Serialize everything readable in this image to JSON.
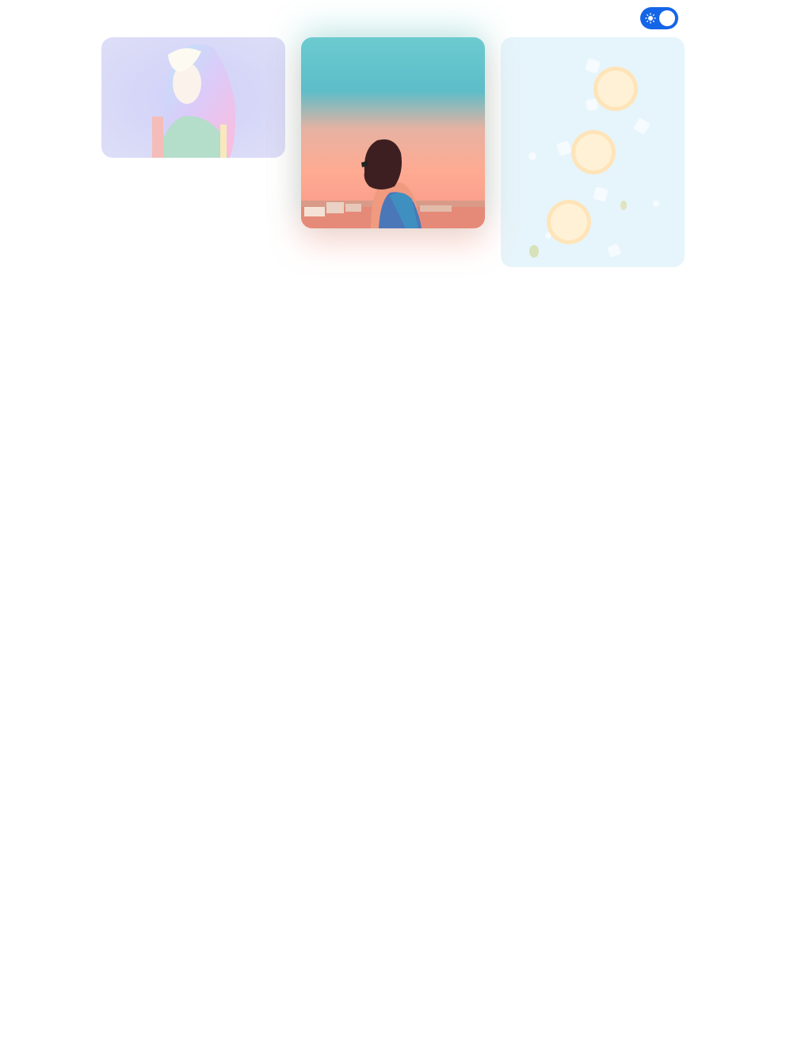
{
  "theme_toggle": {
    "state": "light",
    "icon": "sun-icon",
    "accent_color": "#1565e8"
  },
  "gallery": {
    "cards": [
      {
        "subject": "person-in-colorful-headscarf",
        "active": false
      },
      {
        "subject": "woman-at-sunset",
        "active": true
      },
      {
        "subject": "lemon-slices-on-ice",
        "active": false
      }
    ]
  }
}
